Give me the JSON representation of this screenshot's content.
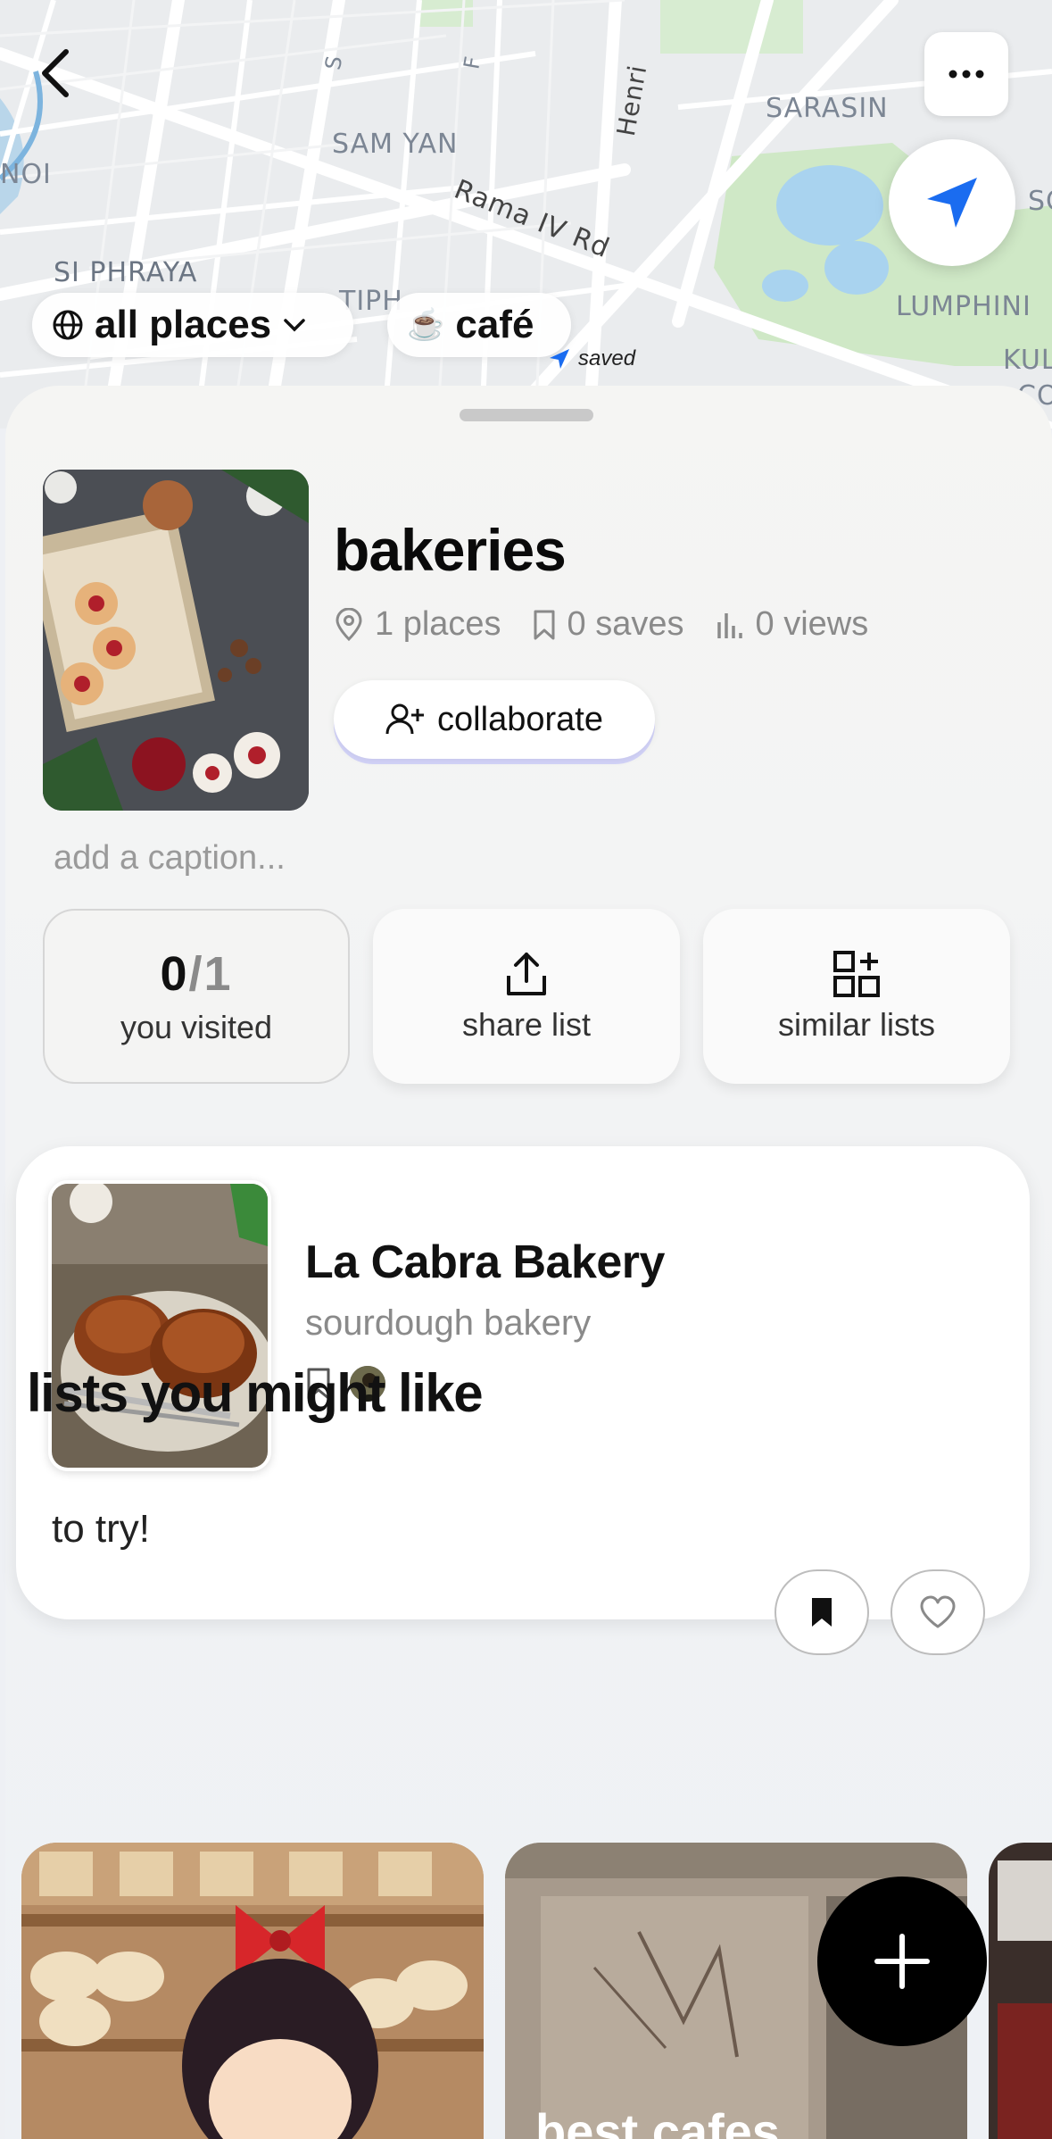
{
  "map": {
    "labels": {
      "sam_yan": "SAM YAN",
      "sarasin": "SARASIN",
      "si_phraya": "SI PHRAYA",
      "lumphini": "LUMPHINI",
      "rama_iv": "Rama IV Rd",
      "henri": "Henri",
      "noi": "NOI",
      "kul": "KUL",
      "co": "CO",
      "tiph": "TIPH",
      "s": "S",
      "f": "F",
      "so": "SO"
    },
    "saved_marker_label": "saved",
    "filters": {
      "all_places": "all places",
      "cafe": "café",
      "cafe_emoji": "☕"
    }
  },
  "list": {
    "title": "bakeries",
    "places": "1 places",
    "saves": "0 saves",
    "views": "0 views",
    "collaborate_label": "collaborate",
    "caption_placeholder": "add a caption..."
  },
  "tiles": {
    "visited_count": "0",
    "visited_total": "1",
    "visited_slash": "/",
    "visited_label": "you visited",
    "share_label": "share list",
    "similar_label": "similar lists"
  },
  "place": {
    "name": "La Cabra Bakery",
    "type": "sourdough bakery",
    "note": "to try!"
  },
  "recommendations": {
    "section_title": "lists you might like",
    "cards": [
      {
        "title": ""
      },
      {
        "title": "best cafes"
      },
      {
        "title": ""
      }
    ]
  },
  "colors": {
    "accent_blue": "#1a6cf0",
    "fab": "#000000"
  }
}
